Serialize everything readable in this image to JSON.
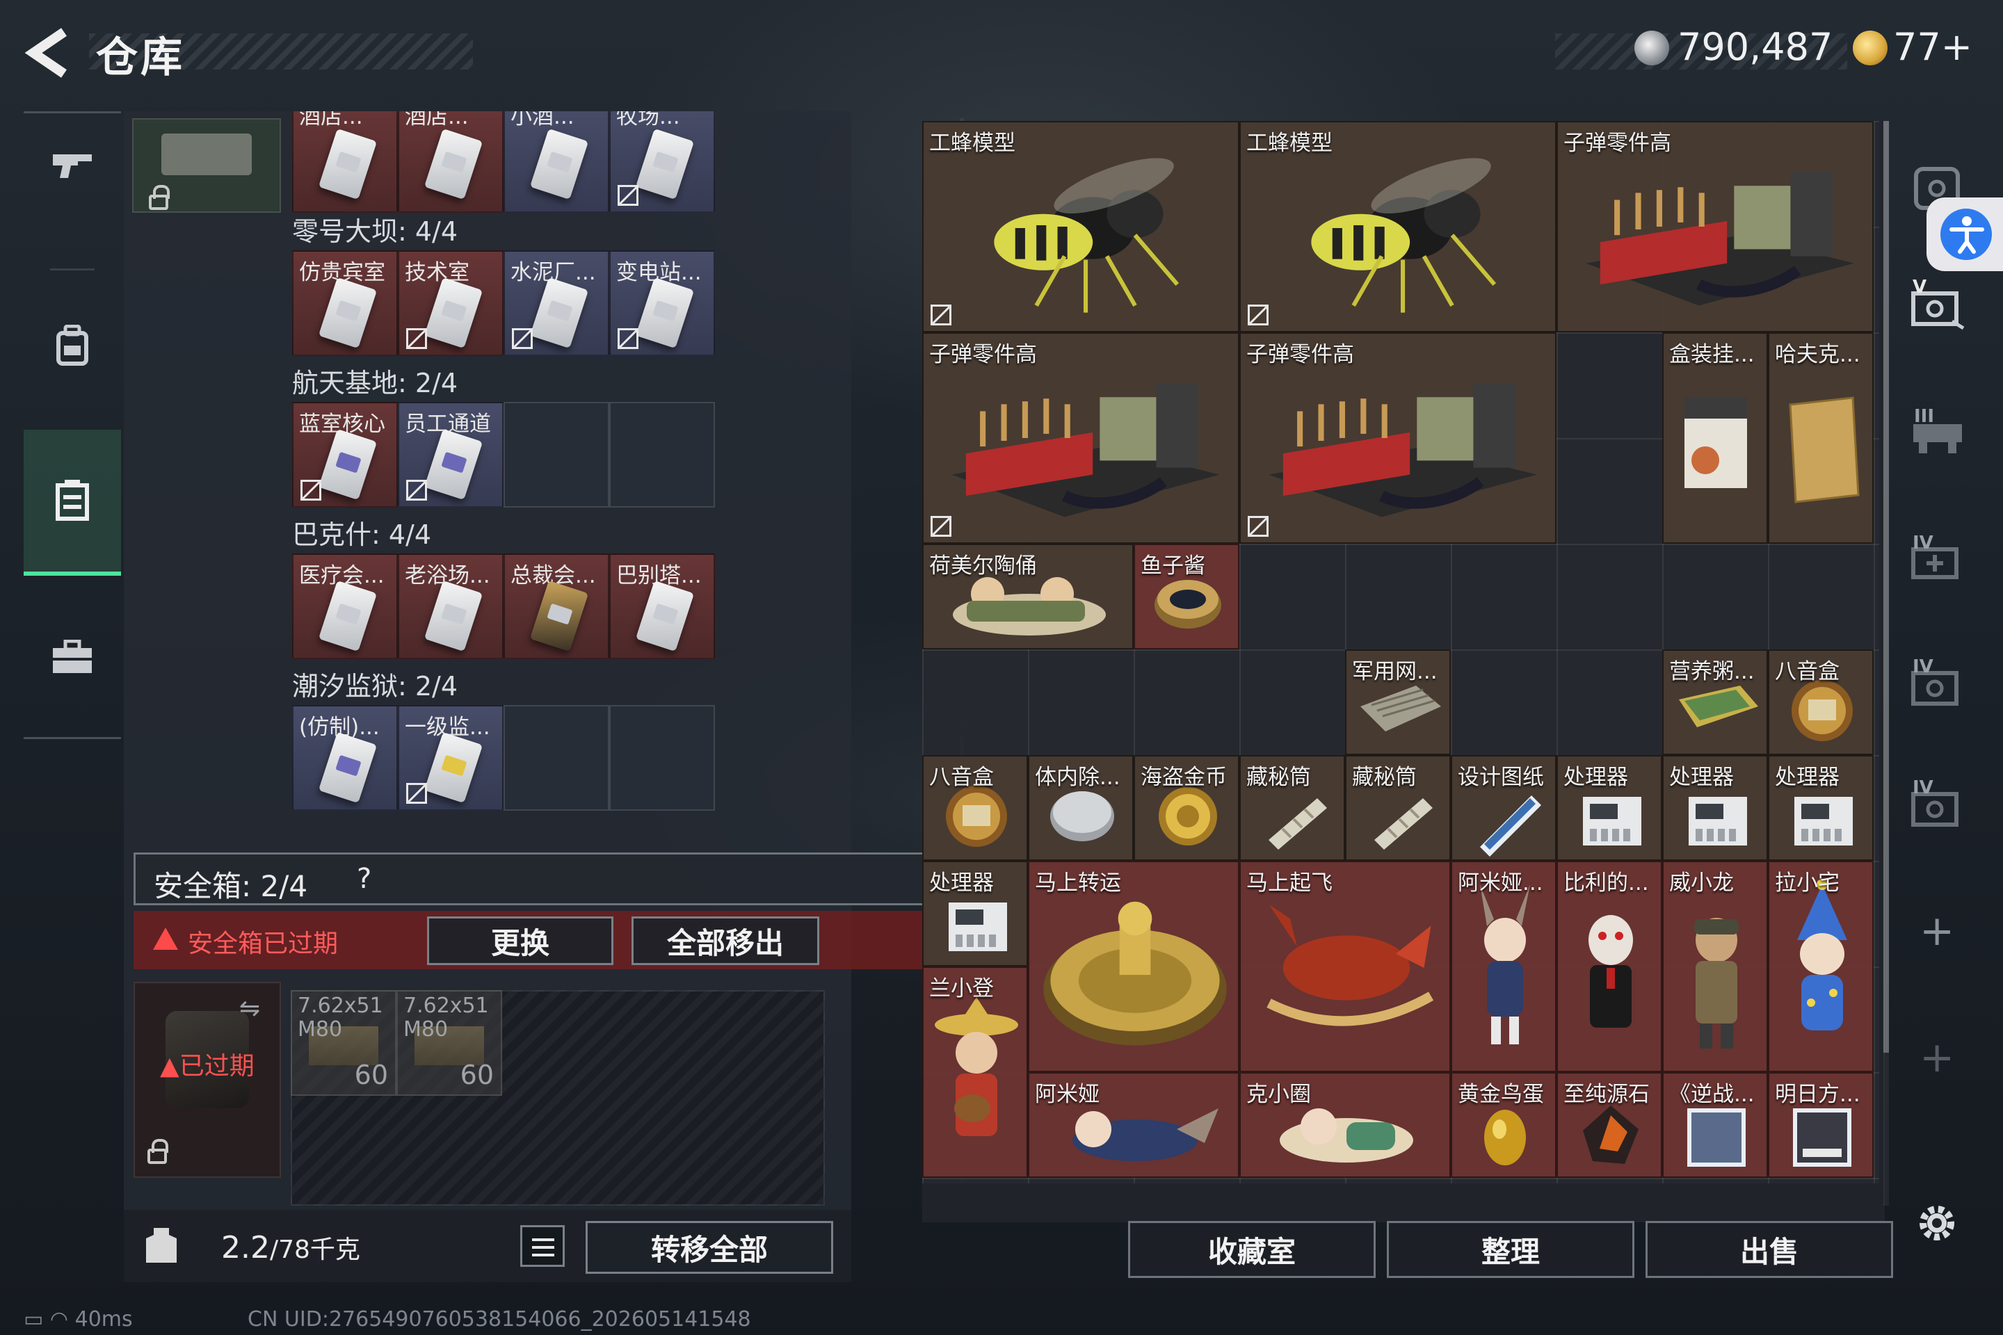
{
  "header": {
    "back_label": "",
    "title": "仓库",
    "currency_silver": "790,487",
    "currency_gold": "77+"
  },
  "left_nav": {
    "items": [
      {
        "icon": "gun-icon",
        "active": false
      },
      {
        "icon": "backpack-icon",
        "active": false
      },
      {
        "icon": "storage-icon",
        "active": true
      },
      {
        "icon": "briefcase-icon",
        "active": false
      }
    ]
  },
  "key_sections": {
    "top_row": [
      "酒店...",
      "酒店...",
      "小酒...",
      "牧场..."
    ],
    "sections": [
      {
        "label": "零号大坝: 4/4",
        "keys": [
          {
            "name": "仿贵宾室",
            "color": "red",
            "card": "white",
            "noicon": false
          },
          {
            "name": "技术室",
            "color": "red",
            "card": "white",
            "noicon": true
          },
          {
            "name": "水泥厂...",
            "color": "blue",
            "card": "white",
            "noicon": true
          },
          {
            "name": "变电站...",
            "color": "blue",
            "card": "white",
            "noicon": true
          }
        ]
      },
      {
        "label": "航天基地: 2/4",
        "keys": [
          {
            "name": "蓝室核心",
            "color": "red",
            "card": "purple",
            "noicon": true
          },
          {
            "name": "员工通道",
            "color": "blue",
            "card": "purple",
            "noicon": true
          },
          {
            "name": "",
            "color": "empty"
          },
          {
            "name": "",
            "color": "empty"
          }
        ]
      },
      {
        "label": "巴克什: 4/4",
        "keys": [
          {
            "name": "医疗会...",
            "color": "red",
            "card": "white",
            "noicon": false
          },
          {
            "name": "老浴场...",
            "color": "red",
            "card": "white",
            "noicon": false
          },
          {
            "name": "总裁会...",
            "color": "red",
            "card": "gold",
            "noicon": false
          },
          {
            "name": "巴别塔...",
            "color": "red",
            "card": "white",
            "noicon": false
          }
        ]
      },
      {
        "label": "潮汐监狱: 2/4",
        "keys": [
          {
            "name": "(仿制)...",
            "color": "blue",
            "card": "purple",
            "noicon": false
          },
          {
            "name": "一级监...",
            "color": "blue",
            "card": "yellow",
            "noicon": true
          },
          {
            "name": "",
            "color": "empty"
          },
          {
            "name": "",
            "color": "empty"
          }
        ]
      }
    ]
  },
  "safe_box": {
    "label": "安全箱: 2/4",
    "help": "?",
    "warning": "安全箱已过期",
    "replace_button": "更换",
    "remove_all_button": "全部移出",
    "expired_tag": "已过期",
    "ammo": [
      {
        "name": "7.62x51\nM80",
        "count": "60"
      },
      {
        "name": "7.62x51\nM80",
        "count": "60"
      }
    ]
  },
  "footer_left": {
    "weight": "2.2",
    "weight_unit": "/78千克",
    "transfer_all_button": "转移全部"
  },
  "status": {
    "ping": "40ms",
    "uid": "CN UID:2765490760538154066_202605141548"
  },
  "stash_items": [
    {
      "name": "工蜂模型",
      "tone": "brown",
      "visual": "wasp",
      "noicon": true
    },
    {
      "name": "工蜂模型",
      "tone": "brown",
      "visual": "wasp",
      "noicon": true
    },
    {
      "name": "子弹零件高",
      "tone": "brown",
      "visual": "ammo-crate",
      "noicon": false
    },
    {
      "name": "子弹零件高",
      "tone": "brown",
      "visual": "ammo-crate",
      "noicon": true
    },
    {
      "name": "子弹零件高",
      "tone": "brown",
      "visual": "ammo-crate",
      "noicon": true
    },
    {
      "name": "盒装挂...",
      "tone": "brown",
      "visual": "box",
      "noicon": false
    },
    {
      "name": "哈夫克...",
      "tone": "brown",
      "visual": "folder",
      "noicon": false
    },
    {
      "name": "荷美尔陶俑",
      "tone": "brown",
      "visual": "figurine",
      "noicon": false
    },
    {
      "name": "鱼子酱",
      "tone": "red",
      "visual": "tin",
      "noicon": false
    },
    {
      "name": "军用网...",
      "tone": "brown",
      "visual": "radiator",
      "noicon": false
    },
    {
      "name": "营养粥...",
      "tone": "brown",
      "visual": "can",
      "noicon": false
    },
    {
      "name": "八音盒",
      "tone": "brown",
      "visual": "music-box",
      "noicon": false
    },
    {
      "name": "八音盒",
      "tone": "brown",
      "visual": "music-box",
      "noicon": false
    },
    {
      "name": "体内除...",
      "tone": "brown",
      "visual": "disc",
      "noicon": false
    },
    {
      "name": "海盗金币",
      "tone": "brown",
      "visual": "coin",
      "noicon": false
    },
    {
      "name": "藏秘筒",
      "tone": "brown",
      "visual": "cylinder",
      "noicon": false
    },
    {
      "name": "藏秘筒",
      "tone": "brown",
      "visual": "cylinder",
      "noicon": false
    },
    {
      "name": "设计图纸",
      "tone": "brown",
      "visual": "blueprint",
      "noicon": false
    },
    {
      "name": "处理器",
      "tone": "brown",
      "visual": "processor",
      "noicon": false
    },
    {
      "name": "处理器",
      "tone": "brown",
      "visual": "processor",
      "noicon": false
    },
    {
      "name": "处理器",
      "tone": "brown",
      "visual": "processor",
      "noicon": false
    },
    {
      "name": "处理器",
      "tone": "brown",
      "visual": "processor",
      "noicon": false
    },
    {
      "name": "马上转运",
      "tone": "red",
      "visual": "gold-disc",
      "noicon": false
    },
    {
      "name": "马上起飞",
      "tone": "red",
      "visual": "horse",
      "noicon": false
    },
    {
      "name": "阿米娅...",
      "tone": "red",
      "visual": "figure",
      "noicon": false
    },
    {
      "name": "比利的...",
      "tone": "red",
      "visual": "figure-dark",
      "noicon": false
    },
    {
      "name": "威小龙",
      "tone": "red",
      "visual": "figure-soldier",
      "noicon": false
    },
    {
      "name": "拉小宅",
      "tone": "red",
      "visual": "figure-blue",
      "noicon": false
    },
    {
      "name": "兰小登",
      "tone": "red",
      "visual": "figure-sombrero",
      "noicon": false
    },
    {
      "name": "阿米娅",
      "tone": "red",
      "visual": "figure-lying",
      "noicon": false
    },
    {
      "name": "克小圈",
      "tone": "red",
      "visual": "figure-lying2",
      "noicon": false
    },
    {
      "name": "黄金鸟蛋",
      "tone": "red",
      "visual": "egg",
      "noicon": false
    },
    {
      "name": "至纯源石",
      "tone": "red",
      "visual": "crystal",
      "noicon": false
    },
    {
      "name": "《逆战...",
      "tone": "red",
      "visual": "card",
      "noicon": false
    },
    {
      "name": "明日方...",
      "tone": "red",
      "visual": "card2",
      "noicon": false
    }
  ],
  "right_footer": {
    "collection_button": "收藏室",
    "sort_button": "整理",
    "sell_button": "出售"
  },
  "right_rail": {
    "items": [
      "safe-icon",
      "storage-v-icon",
      "storage-iii-icon",
      "storage-iv-plus-icon",
      "storage-iv-icon",
      "storage-iv-icon"
    ],
    "romans": [
      "",
      "V",
      "III",
      "IV",
      "IV",
      "IV"
    ]
  },
  "colors": {
    "accent_green": "#4fe3a0",
    "warning_red": "#ff4a4a",
    "item_red": "#6e3432",
    "item_brown": "#4a3c32",
    "access_blue": "#2e7bf0"
  }
}
